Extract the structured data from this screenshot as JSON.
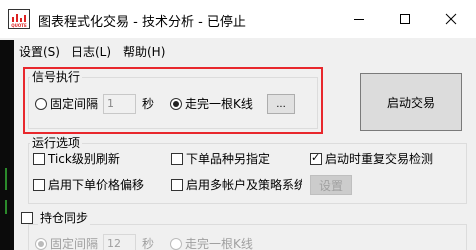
{
  "window": {
    "title": "图表程式化交易 - 技术分析 - 已停止",
    "icon_caption": "QUOTE"
  },
  "menu": [
    {
      "label": "设置(S)"
    },
    {
      "label": "日志(L)"
    },
    {
      "label": "帮助(H)"
    }
  ],
  "signal_group": {
    "label": "信号执行",
    "option_interval_label": "固定间隔",
    "interval_value": "1",
    "interval_unit": "秒",
    "option_bar_label": "走完一根K线",
    "bar_more_label": "...",
    "selected": "bar"
  },
  "start_button": {
    "label": "启动交易"
  },
  "run_group": {
    "label": "运行选项",
    "opt_tick_refresh": {
      "label": "Tick级别刷新",
      "checked": false
    },
    "opt_order_type": {
      "label": "下单品种另指定",
      "checked": false
    },
    "opt_restart_detect": {
      "label": "启动时重复交易检测",
      "checked": true
    },
    "opt_price_offset": {
      "label": "启用下单价格偏移",
      "checked": false
    },
    "opt_multi_account": {
      "label": "启用多帐户及策略系统",
      "checked": false
    },
    "settings_button_label": "设置"
  },
  "position_sync": {
    "label": "持仓同步",
    "checked": false,
    "option_interval_label": "固定间隔",
    "interval_value": "12",
    "interval_unit": "秒",
    "option_bar_label": "走完一根K线"
  }
}
